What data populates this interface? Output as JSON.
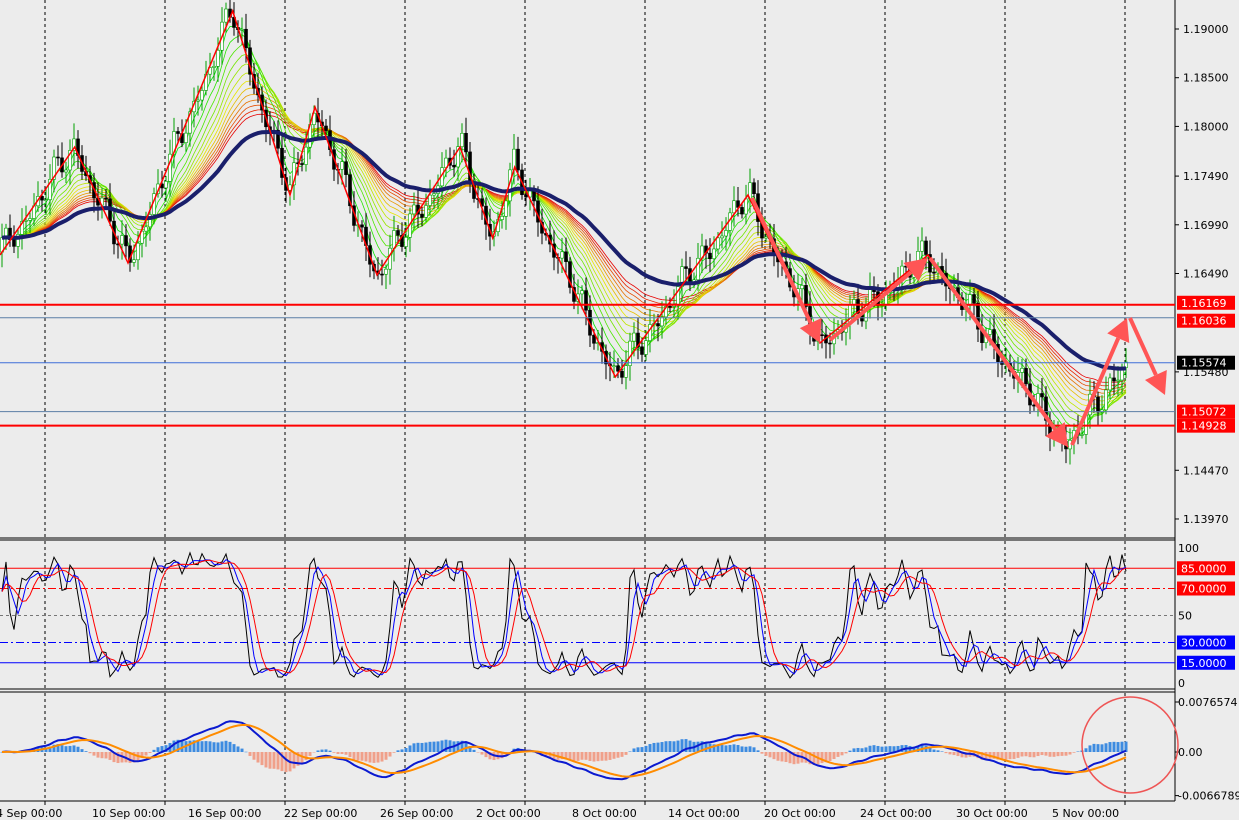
{
  "chart_data": [
    {
      "type": "candlestick",
      "panel": "price",
      "y_ticks": [
        "1.19000",
        "1.18500",
        "1.18000",
        "1.17490",
        "1.16990",
        "1.16490",
        "1.15480",
        "1.14470",
        "1.13970"
      ],
      "ylim": [
        1.1365,
        1.193
      ],
      "x_tick_labels": [
        "4 Sep 00:00",
        "10 Sep 00:00",
        "16 Sep 00:00",
        "22 Sep 00:00",
        "26 Sep 00:00",
        "2 Oct 00:00",
        "8 Oct 00:00",
        "14 Oct 00:00",
        "20 Oct 00:00",
        "24 Oct 00:00",
        "30 Oct 00:00",
        "5 Nov 00:00"
      ],
      "grid": "vertical dashed",
      "zigzag": [
        {
          "time": "4 Sep 06:00",
          "price": 1.1668
        },
        {
          "time": "8 Sep 22:00",
          "price": 1.17789
        },
        {
          "time": "12 Sep 06:00",
          "price": 1.16598
        },
        {
          "time": "18 Sep 19:00",
          "price": 1.19185
        },
        {
          "time": "22 Sep 06:00",
          "price": 1.17296
        },
        {
          "time": "23 Sep 07:00",
          "price": 1.18199
        },
        {
          "time": "25 Sep 21:00",
          "price": 1.16475
        },
        {
          "time": "1 Oct 00:00",
          "price": 1.17789
        },
        {
          "time": "3 Oct 01:00",
          "price": 1.16854
        },
        {
          "time": "4 Oct 10:00",
          "price": 1.17583
        },
        {
          "time": "10 Oct 17:00",
          "price": 1.15428
        },
        {
          "time": "19 Oct 00:00",
          "price": 1.17296
        },
        {
          "time": "22 Oct 08:00",
          "price": 1.15777
        },
        {
          "time": "28 Oct 06:00",
          "price": 1.1668
        },
        {
          "time": "6 Nov 00:00",
          "price": 1.14709
        },
        {
          "time": "9 Nov 12:00",
          "price": 1.15574
        }
      ],
      "horizontal_lines": [
        {
          "label": "1.16169",
          "price": 1.16169,
          "color": "#ff0000",
          "style": "thick"
        },
        {
          "label": "1.16036",
          "price": 1.16036,
          "color": "#5b7fa6",
          "style": "thin"
        },
        {
          "label": "1.15574",
          "price": 1.15574,
          "color": "#3f6fd8",
          "style": "current-price"
        },
        {
          "label": "1.15072",
          "price": 1.15072,
          "color": "#5b7fa6",
          "style": "thin"
        },
        {
          "label": "1.14928",
          "price": 1.14928,
          "color": "#ff0000",
          "style": "thick"
        }
      ],
      "current_price": "1.15574",
      "colors": {
        "bull": "#00a000",
        "bear": "#000000",
        "zigzag": "#ff0000",
        "slow_ma": "#1a1f6b",
        "arrow": "#ff5555"
      }
    },
    {
      "type": "line",
      "panel": "stochastic",
      "ylim": [
        0,
        100
      ],
      "y_ticks": [
        "100",
        "50",
        "0"
      ],
      "levels": [
        {
          "label": "85.0000",
          "value": 85,
          "color": "#ff0000"
        },
        {
          "label": "70.0000",
          "value": 70,
          "color": "#ff0000"
        },
        {
          "label": "30.0000",
          "value": 30,
          "color": "#0000ff"
        },
        {
          "label": "15.0000",
          "value": 15,
          "color": "#0000ff"
        }
      ],
      "series_colors": [
        "#000000",
        "#0000ff",
        "#ff0000"
      ]
    },
    {
      "type": "bar",
      "panel": "macd",
      "ylim": [
        -0.0066789,
        0.0076574
      ],
      "y_ticks": [
        "0.0076574",
        "0.00",
        "-0.0066789"
      ],
      "colors": {
        "positive": "#3d8be0",
        "negative": "#f0a08a",
        "line": "#0b1ad0",
        "signal": "#ff8c00",
        "annotation_circle": "#ee5555"
      }
    }
  ]
}
